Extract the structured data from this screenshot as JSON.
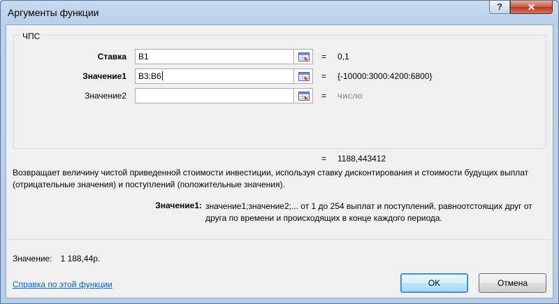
{
  "window": {
    "title": "Аргументы функции",
    "help_glyph": "?",
    "close_glyph": "✕"
  },
  "group": {
    "title": "ЧПС"
  },
  "args": [
    {
      "label": "Ставка",
      "value": "B1",
      "result": "0,1"
    },
    {
      "label": "Значение1",
      "value": "B3:B6",
      "result": "{-10000:3000:4200:6800}"
    },
    {
      "label": "Значение2",
      "value": "",
      "result": "число"
    }
  ],
  "equals": "=",
  "formula_result": "1188,443412",
  "description": "Возвращает величину чистой приведенной стоимости инвестиции, используя ставку дисконтирования и стоимости будущих выплат (отрицательные значения) и поступлений (положительные значения).",
  "arg_help": {
    "label": "Значение1:",
    "text": "значение1;значение2;... от 1 до 254 выплат и поступлений, равноотстоящих друг от друга по времени и происходящих в конце каждого периода."
  },
  "value_row": {
    "label": "Значение:",
    "value": "1 188,44р."
  },
  "help_link": "Справка по этой функции",
  "buttons": {
    "ok": "OK",
    "cancel": "Отмена"
  },
  "icons": {
    "ref": "collapse-dialog-icon"
  }
}
